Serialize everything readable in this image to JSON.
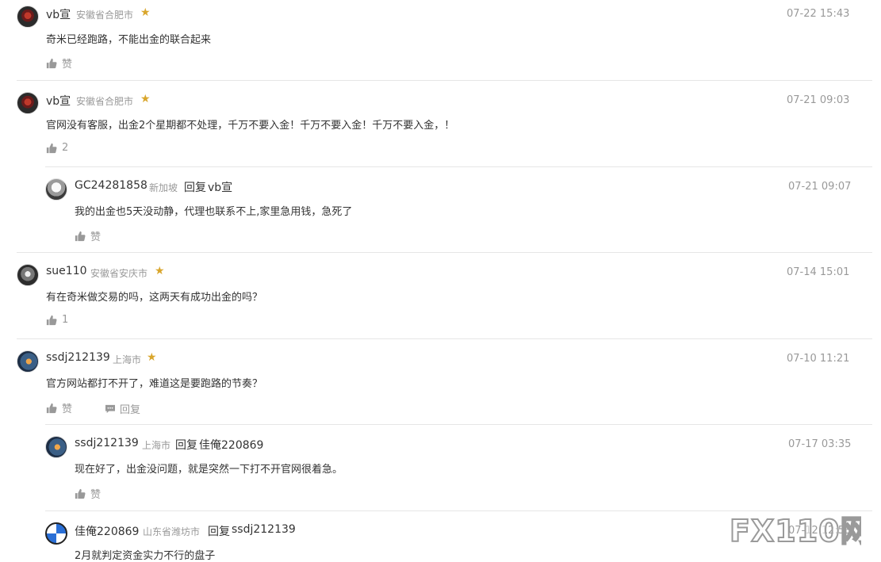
{
  "comments": [
    {
      "user": "vb宣",
      "location": "安徽省合肥市",
      "time": "07-22 15:43",
      "text": "奇米已经跑路，不能出金的联合起来",
      "like_label": "赞"
    },
    {
      "user": "vb宣",
      "location": "安徽省合肥市",
      "time": "07-21 09:03",
      "text": "官网没有客服，出金2个星期都不处理，千万不要入金！千万不要入金！千万不要入金，！",
      "like_label": "2",
      "replies": [
        {
          "user": "GC24281858",
          "location": "新加坡",
          "reply_word": "回复",
          "reply_to": "vb宣",
          "time": "07-21 09:07",
          "text": "我的出金也5天没动静，代理也联系不上,家里急用钱，急死了",
          "like_label": "赞"
        }
      ]
    },
    {
      "user": "sue110",
      "location": "安徽省安庆市",
      "time": "07-14 15:01",
      "text": "有在奇米做交易的吗，这两天有成功出金的吗？",
      "like_label": "1"
    },
    {
      "user": "ssdj212139",
      "location": "上海市",
      "time": "07-10 11:21",
      "text": "官方网站都打不开了，难道这是要跑路的节奏？",
      "like_label": "赞",
      "reply_label": "回复",
      "replies": [
        {
          "user": "ssdj212139",
          "location": "上海市",
          "reply_word": "回复",
          "reply_to": "佳俺220869",
          "time": "07-17 03:35",
          "text": "现在好了，出金没问题，就是突然一下打不开官网很着急。",
          "like_label": "赞"
        },
        {
          "user": "佳俺220869",
          "location": "山东省潍坊市",
          "reply_word": "回复",
          "reply_to": "ssdj212139",
          "time": "07-12 12:53",
          "text": "2月就判定资金实力不行的盘子"
        }
      ]
    }
  ],
  "watermark": "FX110网",
  "colors": {
    "star": "#d9a62c",
    "muted": "#999999",
    "text": "#333333",
    "divider": "#e6e6e6"
  }
}
